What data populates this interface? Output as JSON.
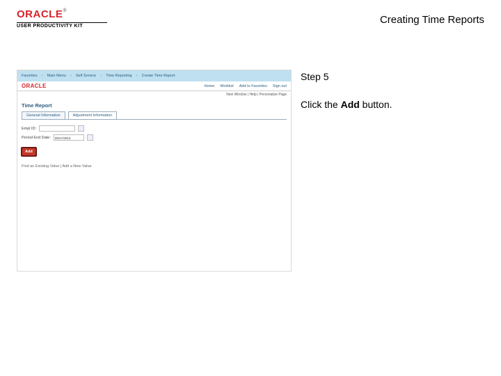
{
  "header": {
    "brand_word": "ORACLE",
    "brand_tm": "®",
    "brand_sub": "USER PRODUCTIVITY KIT",
    "title": "Creating Time Reports"
  },
  "screenshot": {
    "topbar": {
      "items": [
        "Favorites",
        "Main Menu",
        "Self Service",
        "Time Reporting",
        "Create Time Report"
      ],
      "sep": "›"
    },
    "logobar": {
      "brand": "ORACLE",
      "right": [
        "Home",
        "Worklist",
        "Add to Favorites",
        "Sign out"
      ]
    },
    "info_line": "New Window | Help | Personalize Page",
    "heading": "Time Report",
    "tabs": [
      "General Information",
      "Adjustment Information"
    ],
    "fields": {
      "empl_label": "Empl ID:",
      "empl_value": "",
      "date_label": "Period End Date:",
      "date_value": "05/17/2013"
    },
    "add_button": "Add",
    "note": "Find an Existing Value | Add a New Value"
  },
  "instructions": {
    "step": "Step 5",
    "line_pre": "Click the ",
    "line_bold": "Add",
    "line_post": " button."
  }
}
